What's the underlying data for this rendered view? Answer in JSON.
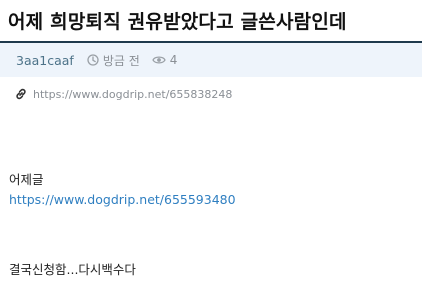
{
  "post": {
    "title": "어제 희망퇴직 권유받았다고 글쓴사람인데",
    "author": "3aa1caaf",
    "time": "방금 전",
    "views": "4",
    "source_url": "https://www.dogdrip.net/655838248"
  },
  "content": {
    "line1": "어제글",
    "link": "https://www.dogdrip.net/655593480",
    "line2": "결국신청함...다시백수다"
  },
  "icons": {
    "time": "clock-icon",
    "views": "eye-icon",
    "link": "link-icon"
  },
  "colors": {
    "title_rule": "#1f3a4d",
    "meta_background": "#eef4fb",
    "author": "#4d7389",
    "link": "#2f7fc1"
  }
}
